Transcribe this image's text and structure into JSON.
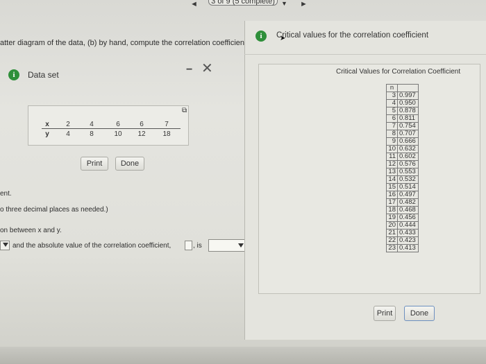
{
  "topbar": {
    "progress_text": "3 of 9 (5 complete)",
    "left_arrow": "◄",
    "right_arrow": "►",
    "caret": "▼"
  },
  "question": {
    "line1": "atter diagram of the data, (b) by hand, compute the correlation coefficient, a",
    "line_ent": "ent.",
    "line_decimals": "o three decimal places as needed.)",
    "line_relation": "on between x and y.",
    "line_abs_a": "and the absolute value of the correlation coefficient,",
    "line_abs_b": ", is"
  },
  "dataset_window": {
    "title": "Data set",
    "minimize": "−",
    "close": "✕",
    "table": {
      "x_label": "x",
      "y_label": "y",
      "x_values": [
        "2",
        "4",
        "6",
        "6",
        "7"
      ],
      "y_values": [
        "4",
        "8",
        "10",
        "12",
        "18"
      ]
    },
    "print_label": "Print",
    "done_label": "Done"
  },
  "critical_window": {
    "header_title": "Critical values for the correlation coefficient",
    "panel_title": "Critical Values for Correlation Coefficient",
    "column_header": "n",
    "rows": [
      {
        "n": "3",
        "v": "0.997"
      },
      {
        "n": "4",
        "v": "0.950"
      },
      {
        "n": "5",
        "v": "0.878"
      },
      {
        "n": "6",
        "v": "0.811"
      },
      {
        "n": "7",
        "v": "0.754"
      },
      {
        "n": "8",
        "v": "0.707"
      },
      {
        "n": "9",
        "v": "0.666"
      },
      {
        "n": "10",
        "v": "0.632"
      },
      {
        "n": "11",
        "v": "0.602"
      },
      {
        "n": "12",
        "v": "0.576"
      },
      {
        "n": "13",
        "v": "0.553"
      },
      {
        "n": "14",
        "v": "0.532"
      },
      {
        "n": "15",
        "v": "0.514"
      },
      {
        "n": "16",
        "v": "0.497"
      },
      {
        "n": "17",
        "v": "0.482"
      },
      {
        "n": "18",
        "v": "0.468"
      },
      {
        "n": "19",
        "v": "0.456"
      },
      {
        "n": "20",
        "v": "0.444"
      },
      {
        "n": "21",
        "v": "0.433"
      },
      {
        "n": "22",
        "v": "0.423"
      },
      {
        "n": "23",
        "v": "0.413"
      }
    ],
    "print_label": "Print",
    "done_label": "Done"
  },
  "colors": {
    "info_green": "#2f8f3a",
    "done_border": "#6c8fbf"
  },
  "icons": {
    "info": "info-icon",
    "cursor": "cursor-icon",
    "dropdown": "chevron-down-icon",
    "copy": "copy-icon"
  }
}
